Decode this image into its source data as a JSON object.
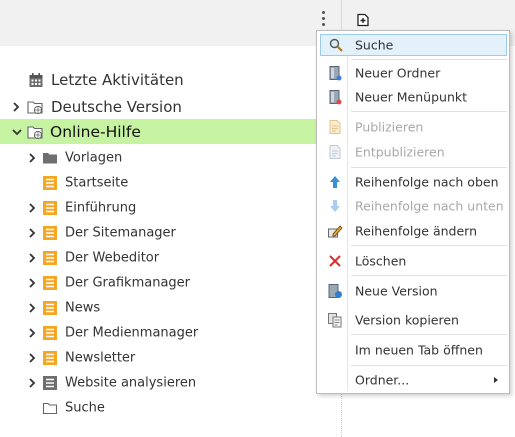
{
  "tree": {
    "top": [
      {
        "label": "Letzte Aktivitäten"
      },
      {
        "label": "Deutsche Version"
      },
      {
        "label": "Online-Hilfe"
      }
    ],
    "children": [
      {
        "label": "Vorlagen"
      },
      {
        "label": "Startseite"
      },
      {
        "label": "Einführung"
      },
      {
        "label": "Der Sitemanager"
      },
      {
        "label": "Der Webeditor"
      },
      {
        "label": "Der Grafikmanager"
      },
      {
        "label": "News"
      },
      {
        "label": "Der Medienmanager"
      },
      {
        "label": "Newsletter"
      },
      {
        "label": "Website analysieren"
      },
      {
        "label": "Suche"
      }
    ]
  },
  "menu": {
    "items": [
      {
        "label": "Suche"
      },
      {
        "label": "Neuer Ordner"
      },
      {
        "label": "Neuer Menüpunkt"
      },
      {
        "label": "Publizieren"
      },
      {
        "label": "Entpublizieren"
      },
      {
        "label": "Reihenfolge nach oben"
      },
      {
        "label": "Reihenfolge nach unten"
      },
      {
        "label": "Reihenfolge ändern"
      },
      {
        "label": "Löschen"
      },
      {
        "label": "Neue Version"
      },
      {
        "label": "Version kopieren"
      },
      {
        "label": "Im neuen Tab öffnen"
      },
      {
        "label": "Ordner..."
      }
    ]
  },
  "colors": {
    "active_row": "#c5f3a1",
    "menu_highlight": "#e3f1fb",
    "page_icon": "#f5a623"
  }
}
